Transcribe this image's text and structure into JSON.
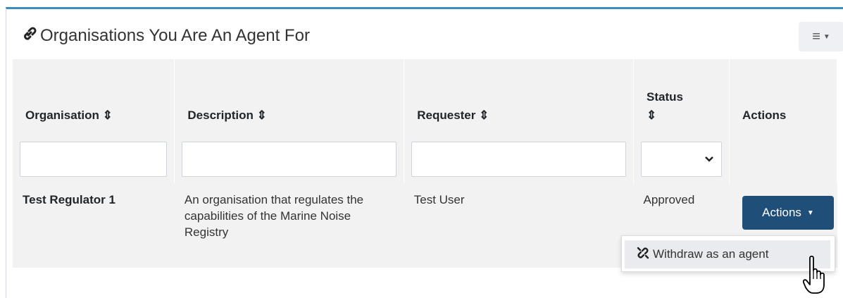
{
  "panel": {
    "title": "Organisations You Are An Agent For",
    "accent_color": "#3c8dbc",
    "icons": {
      "title": "link-icon",
      "menu": "hamburger-menu-icon"
    }
  },
  "table": {
    "columns": [
      {
        "label": "Organisation",
        "sort_icon": "sort-icon"
      },
      {
        "label": "Description",
        "sort_icon": "sort-icon"
      },
      {
        "label": "Requester",
        "sort_icon": "sort-icon"
      },
      {
        "label": "Status",
        "sort_icon": "sort-icon"
      },
      {
        "label": "Actions"
      }
    ],
    "sort_glyph": "⇕",
    "filters": {
      "organisation": "",
      "description": "",
      "requester": "",
      "status": ""
    },
    "rows": [
      {
        "organisation": "Test Regulator 1",
        "description": "An organisation that regulates the capabilities of the Marine Noise Registry",
        "requester": "Test User",
        "status": "Approved"
      }
    ]
  },
  "actions": {
    "button_label": "Actions",
    "button_color": "#1f4e79",
    "menu_items": [
      {
        "label": "Withdraw as an agent",
        "icon": "unlink-icon"
      }
    ]
  }
}
